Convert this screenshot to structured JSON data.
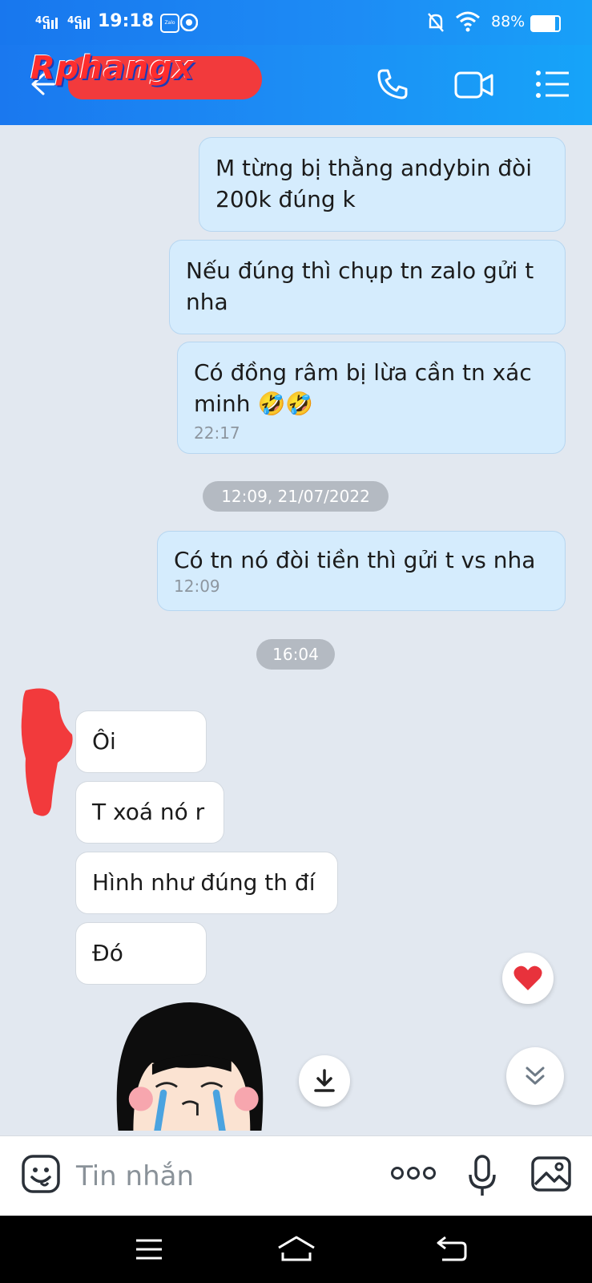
{
  "status_bar": {
    "network_1": "4G",
    "network_2": "4G",
    "time": "19:18",
    "zalo_badge": "Zalo",
    "battery": "88%"
  },
  "header": {
    "contact_name": "Rphangx",
    "back_icon": "back-arrow-icon",
    "call_icon": "phone-icon",
    "video_icon": "video-camera-icon",
    "menu_icon": "list-menu-icon"
  },
  "messages": [
    {
      "direction": "out",
      "text": "M từng bị thằng andybin đòi 200k đúng k"
    },
    {
      "direction": "out",
      "text": "Nếu đúng thì chụp tn zalo gửi t nha"
    },
    {
      "direction": "out",
      "text": "Có đồng râm bị lừa cần tn xác minh 🤣🤣",
      "time": "22:17"
    },
    {
      "direction": "out",
      "text": "Có tn nó đòi tiền thì gửi t vs nha",
      "time": "12:09"
    },
    {
      "direction": "in",
      "text": "Ôi"
    },
    {
      "direction": "in",
      "text": "T xoá nó r"
    },
    {
      "direction": "in",
      "text": "Hình như đúng th đí"
    },
    {
      "direction": "in",
      "text": "Đó"
    }
  ],
  "date_separators": [
    "12:09, 21/07/2022",
    "16:04"
  ],
  "reaction_icon": "heart-icon",
  "scroll_down_icon": "double-chevron-down-icon",
  "download_icon": "download-icon",
  "input": {
    "placeholder": "Tin nhắn",
    "emoji_icon": "sticker-face-icon",
    "more_icon": "more-dots-icon",
    "mic_icon": "microphone-icon",
    "image_icon": "image-icon"
  },
  "colors": {
    "header_blue": "#1c8ff5",
    "outgoing_bubble": "#d5ecfd",
    "incoming_bubble": "#ffffff",
    "chat_bg": "#e2e8f0",
    "redaction_red": "#f23a3c"
  }
}
